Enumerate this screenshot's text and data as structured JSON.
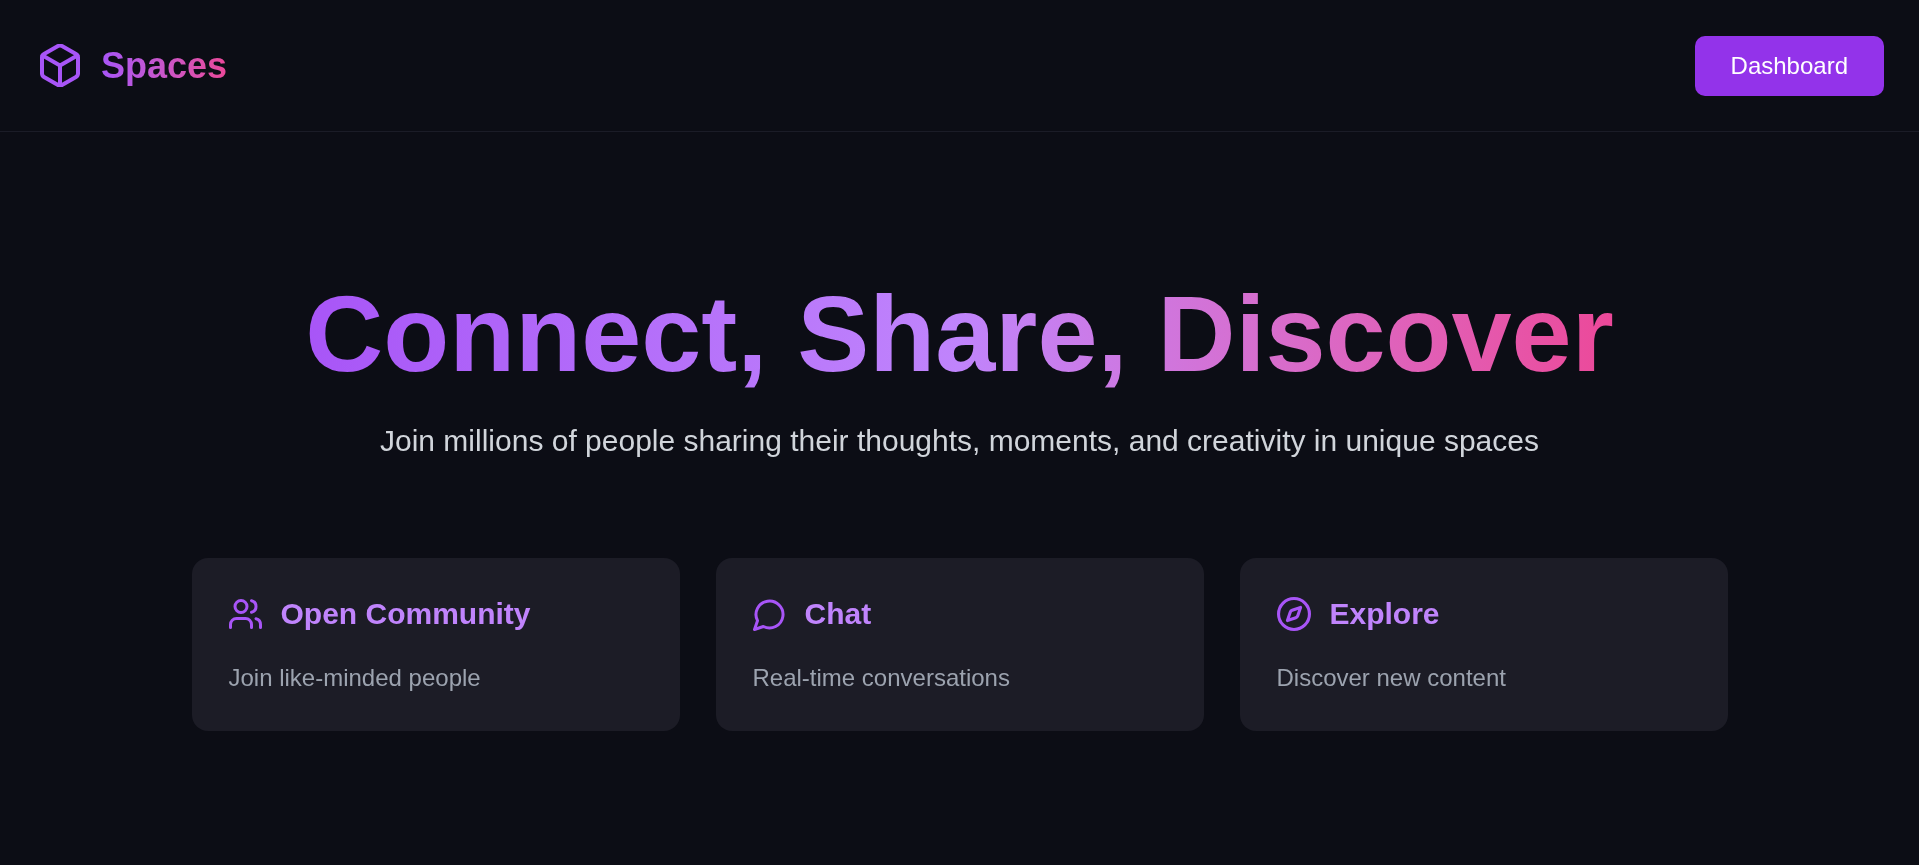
{
  "header": {
    "brand": "Spaces",
    "button": "Dashboard"
  },
  "hero": {
    "title": "Connect, Share, Discover",
    "subtitle": "Join millions of people sharing their thoughts, moments, and creativity in unique spaces"
  },
  "features": [
    {
      "kind": "community",
      "title": "Open Community",
      "description": "Join like-minded people"
    },
    {
      "kind": "chat",
      "title": "Chat",
      "description": "Real-time conversations"
    },
    {
      "kind": "explore",
      "title": "Explore",
      "description": "Discover new content"
    }
  ]
}
